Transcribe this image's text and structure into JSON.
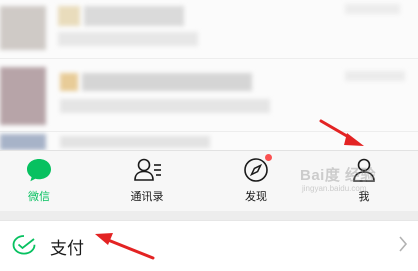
{
  "tabbar": {
    "tabs": [
      {
        "label": "微信",
        "icon": "chat-bubble-icon",
        "active": true
      },
      {
        "label": "通讯录",
        "icon": "contacts-icon",
        "active": false
      },
      {
        "label": "发现",
        "icon": "compass-icon",
        "active": false,
        "badge": true
      },
      {
        "label": "我",
        "icon": "person-icon",
        "active": false
      }
    ]
  },
  "watermark": {
    "text": "Bai度 经验",
    "sub": "jingyan.baidu.com"
  },
  "pay_row": {
    "label": "支付",
    "icon": "pay-icon"
  },
  "colors": {
    "accent": "#07c160",
    "badge": "#fa5151",
    "arrow": "#e32323"
  }
}
